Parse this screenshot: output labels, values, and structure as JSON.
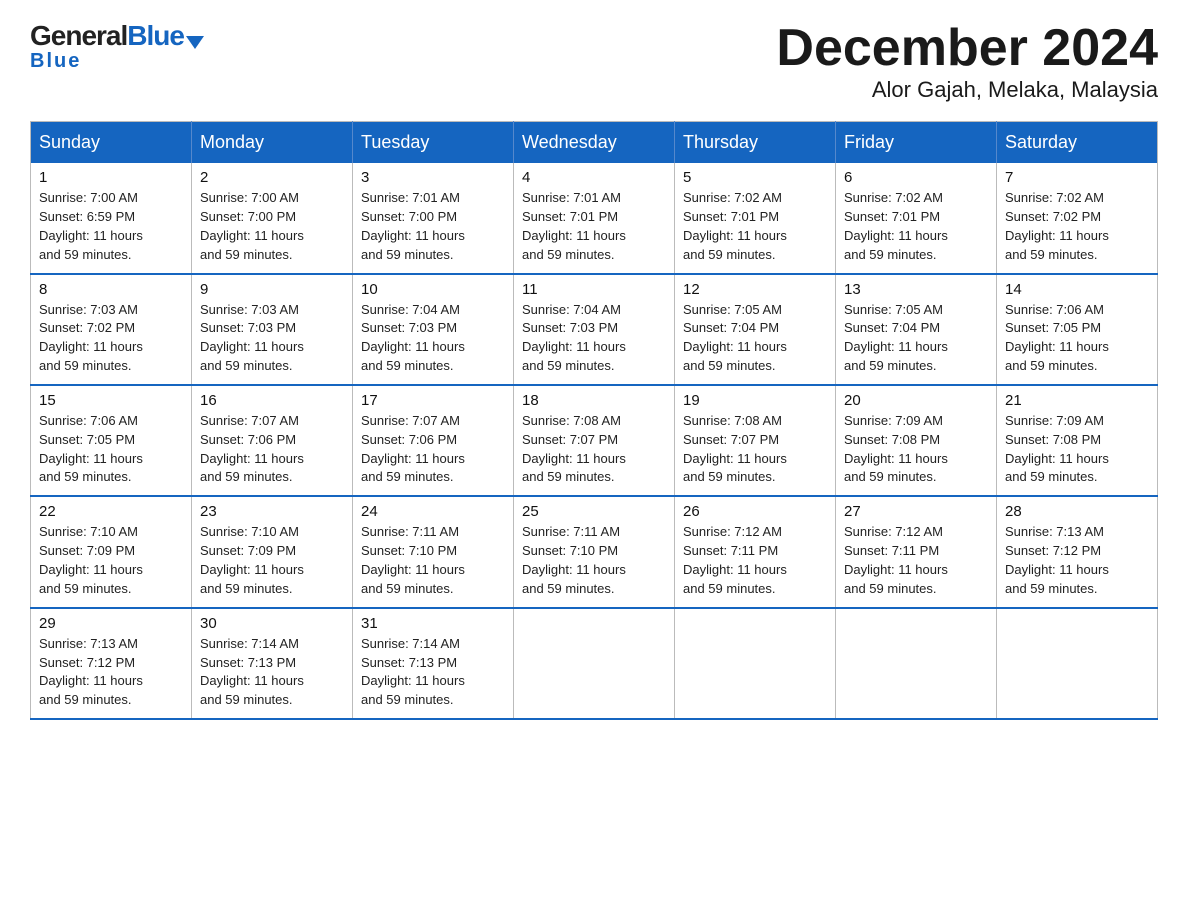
{
  "header": {
    "logo_general": "General",
    "logo_blue": "Blue",
    "title": "December 2024",
    "subtitle": "Alor Gajah, Melaka, Malaysia"
  },
  "days_of_week": [
    "Sunday",
    "Monday",
    "Tuesday",
    "Wednesday",
    "Thursday",
    "Friday",
    "Saturday"
  ],
  "weeks": [
    [
      {
        "day": "1",
        "sunrise": "7:00 AM",
        "sunset": "6:59 PM",
        "daylight": "11 hours and 59 minutes."
      },
      {
        "day": "2",
        "sunrise": "7:00 AM",
        "sunset": "7:00 PM",
        "daylight": "11 hours and 59 minutes."
      },
      {
        "day": "3",
        "sunrise": "7:01 AM",
        "sunset": "7:00 PM",
        "daylight": "11 hours and 59 minutes."
      },
      {
        "day": "4",
        "sunrise": "7:01 AM",
        "sunset": "7:01 PM",
        "daylight": "11 hours and 59 minutes."
      },
      {
        "day": "5",
        "sunrise": "7:02 AM",
        "sunset": "7:01 PM",
        "daylight": "11 hours and 59 minutes."
      },
      {
        "day": "6",
        "sunrise": "7:02 AM",
        "sunset": "7:01 PM",
        "daylight": "11 hours and 59 minutes."
      },
      {
        "day": "7",
        "sunrise": "7:02 AM",
        "sunset": "7:02 PM",
        "daylight": "11 hours and 59 minutes."
      }
    ],
    [
      {
        "day": "8",
        "sunrise": "7:03 AM",
        "sunset": "7:02 PM",
        "daylight": "11 hours and 59 minutes."
      },
      {
        "day": "9",
        "sunrise": "7:03 AM",
        "sunset": "7:03 PM",
        "daylight": "11 hours and 59 minutes."
      },
      {
        "day": "10",
        "sunrise": "7:04 AM",
        "sunset": "7:03 PM",
        "daylight": "11 hours and 59 minutes."
      },
      {
        "day": "11",
        "sunrise": "7:04 AM",
        "sunset": "7:03 PM",
        "daylight": "11 hours and 59 minutes."
      },
      {
        "day": "12",
        "sunrise": "7:05 AM",
        "sunset": "7:04 PM",
        "daylight": "11 hours and 59 minutes."
      },
      {
        "day": "13",
        "sunrise": "7:05 AM",
        "sunset": "7:04 PM",
        "daylight": "11 hours and 59 minutes."
      },
      {
        "day": "14",
        "sunrise": "7:06 AM",
        "sunset": "7:05 PM",
        "daylight": "11 hours and 59 minutes."
      }
    ],
    [
      {
        "day": "15",
        "sunrise": "7:06 AM",
        "sunset": "7:05 PM",
        "daylight": "11 hours and 59 minutes."
      },
      {
        "day": "16",
        "sunrise": "7:07 AM",
        "sunset": "7:06 PM",
        "daylight": "11 hours and 59 minutes."
      },
      {
        "day": "17",
        "sunrise": "7:07 AM",
        "sunset": "7:06 PM",
        "daylight": "11 hours and 59 minutes."
      },
      {
        "day": "18",
        "sunrise": "7:08 AM",
        "sunset": "7:07 PM",
        "daylight": "11 hours and 59 minutes."
      },
      {
        "day": "19",
        "sunrise": "7:08 AM",
        "sunset": "7:07 PM",
        "daylight": "11 hours and 59 minutes."
      },
      {
        "day": "20",
        "sunrise": "7:09 AM",
        "sunset": "7:08 PM",
        "daylight": "11 hours and 59 minutes."
      },
      {
        "day": "21",
        "sunrise": "7:09 AM",
        "sunset": "7:08 PM",
        "daylight": "11 hours and 59 minutes."
      }
    ],
    [
      {
        "day": "22",
        "sunrise": "7:10 AM",
        "sunset": "7:09 PM",
        "daylight": "11 hours and 59 minutes."
      },
      {
        "day": "23",
        "sunrise": "7:10 AM",
        "sunset": "7:09 PM",
        "daylight": "11 hours and 59 minutes."
      },
      {
        "day": "24",
        "sunrise": "7:11 AM",
        "sunset": "7:10 PM",
        "daylight": "11 hours and 59 minutes."
      },
      {
        "day": "25",
        "sunrise": "7:11 AM",
        "sunset": "7:10 PM",
        "daylight": "11 hours and 59 minutes."
      },
      {
        "day": "26",
        "sunrise": "7:12 AM",
        "sunset": "7:11 PM",
        "daylight": "11 hours and 59 minutes."
      },
      {
        "day": "27",
        "sunrise": "7:12 AM",
        "sunset": "7:11 PM",
        "daylight": "11 hours and 59 minutes."
      },
      {
        "day": "28",
        "sunrise": "7:13 AM",
        "sunset": "7:12 PM",
        "daylight": "11 hours and 59 minutes."
      }
    ],
    [
      {
        "day": "29",
        "sunrise": "7:13 AM",
        "sunset": "7:12 PM",
        "daylight": "11 hours and 59 minutes."
      },
      {
        "day": "30",
        "sunrise": "7:14 AM",
        "sunset": "7:13 PM",
        "daylight": "11 hours and 59 minutes."
      },
      {
        "day": "31",
        "sunrise": "7:14 AM",
        "sunset": "7:13 PM",
        "daylight": "11 hours and 59 minutes."
      },
      null,
      null,
      null,
      null
    ]
  ],
  "labels": {
    "sunrise": "Sunrise:",
    "sunset": "Sunset:",
    "daylight": "Daylight:"
  }
}
